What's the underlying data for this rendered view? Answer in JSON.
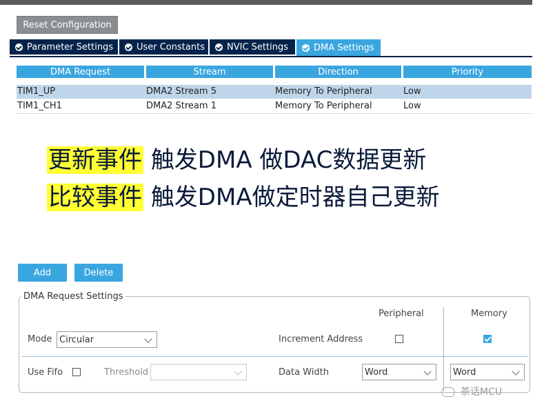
{
  "toolbar": {
    "reset_label": "Reset Configuration"
  },
  "tabs": [
    {
      "label": "Parameter Settings",
      "active": false
    },
    {
      "label": "User Constants",
      "active": false
    },
    {
      "label": "NVIC Settings",
      "active": false
    },
    {
      "label": "DMA Settings",
      "active": true
    }
  ],
  "table": {
    "columns": [
      "DMA Request",
      "Stream",
      "Direction",
      "Priority"
    ],
    "rows": [
      {
        "request": "TIM1_UP",
        "stream": "DMA2 Stream 5",
        "direction": "Memory To Peripheral",
        "priority": "Low",
        "selected": true
      },
      {
        "request": "TIM1_CH1",
        "stream": "DMA2 Stream 1",
        "direction": "Memory To Peripheral",
        "priority": "Low",
        "selected": false
      }
    ]
  },
  "annotation": {
    "line1_highlight": "更新事件",
    "line1_rest": "触发DMA 做DAC数据更新",
    "line2_highlight": "比较事件",
    "line2_rest": "触发DMA做定时器自己更新",
    "highlight_color": "#ffff33"
  },
  "actions": {
    "add_label": "Add",
    "delete_label": "Delete"
  },
  "request_settings": {
    "legend": "DMA Request Settings",
    "peripheral_header": "Peripheral",
    "memory_header": "Memory",
    "mode_label": "Mode",
    "mode_value": "Circular",
    "increment_address_label": "Increment Address",
    "peripheral_increment": false,
    "memory_increment": true,
    "use_fifo_label": "Use Fifo",
    "use_fifo": false,
    "threshold_label": "Threshold",
    "threshold_value": "",
    "data_width_label": "Data Width",
    "peripheral_data_width": "Word",
    "memory_data_width": "Word"
  },
  "watermark": "茶话MCU",
  "colors": {
    "accent": "#3aa6e0",
    "tab_dark": "#03234b",
    "selected_row": "#bfd5ea"
  }
}
